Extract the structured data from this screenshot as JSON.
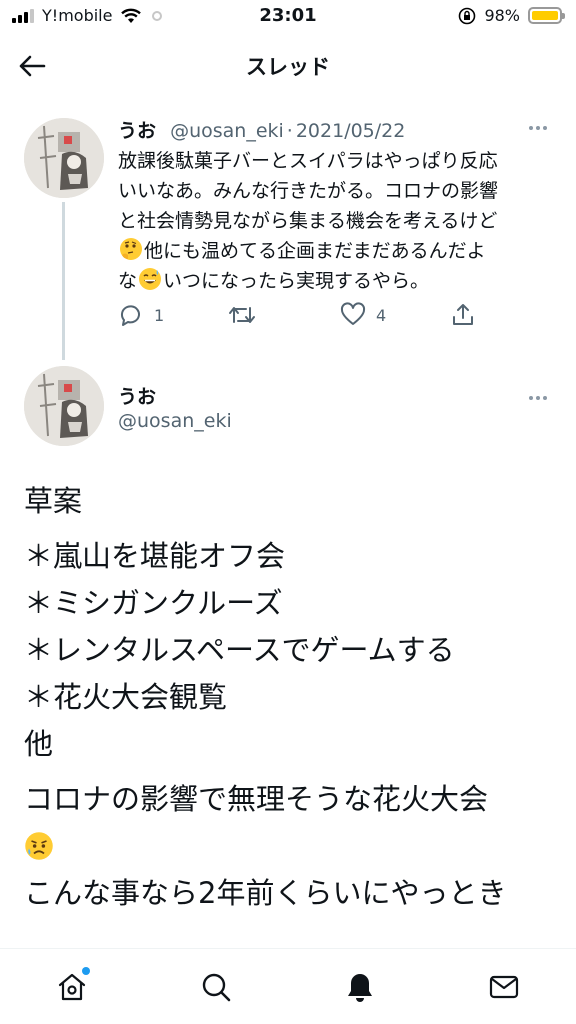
{
  "status_bar": {
    "carrier": "Y!mobile",
    "time": "23:01",
    "battery": "98%"
  },
  "nav": {
    "title": "スレッド"
  },
  "parent_tweet": {
    "name": "うお",
    "handle": "@uosan_eki",
    "separator": "·",
    "date": "2021/05/22",
    "body_line1": "放課後駄菓子バーとスイパラはやっぱり反応",
    "body_line2": "いいなあ。みんな行きたがる。コロナの影響",
    "body_line3": "と社会情勢見ながら集まる機会を考えるけど",
    "body_line4b": "他にも温めてる企画まだまだあるんだよ",
    "body_line5a": "な",
    "body_line5b": "いつになったら実現するやら。",
    "emoji1": "thinking-face-icon",
    "emoji2": "grinning-sweat-face-icon",
    "reply_count": "1",
    "retweet_count": "",
    "like_count": "4"
  },
  "main_tweet": {
    "name": "うお",
    "handle": "@uosan_eki",
    "lines": [
      "草案",
      "＊嵐山を堪能オフ会",
      "＊ミシガンクルーズ",
      "＊レンタルスペースでゲームする",
      "＊花火大会観覧",
      "他",
      "コロナの影響で無理そうな花火大会",
      "こんな事なら2年前くらいにやっとき"
    ],
    "emoji": "sad-sweat-face-icon"
  },
  "tabbar": {
    "items": [
      "home-icon",
      "search-icon",
      "notifications-icon",
      "messages-icon"
    ]
  },
  "colors": {
    "accent": "#1d9bf0",
    "secondary_text": "#536471",
    "battery": "#ffcc00"
  }
}
